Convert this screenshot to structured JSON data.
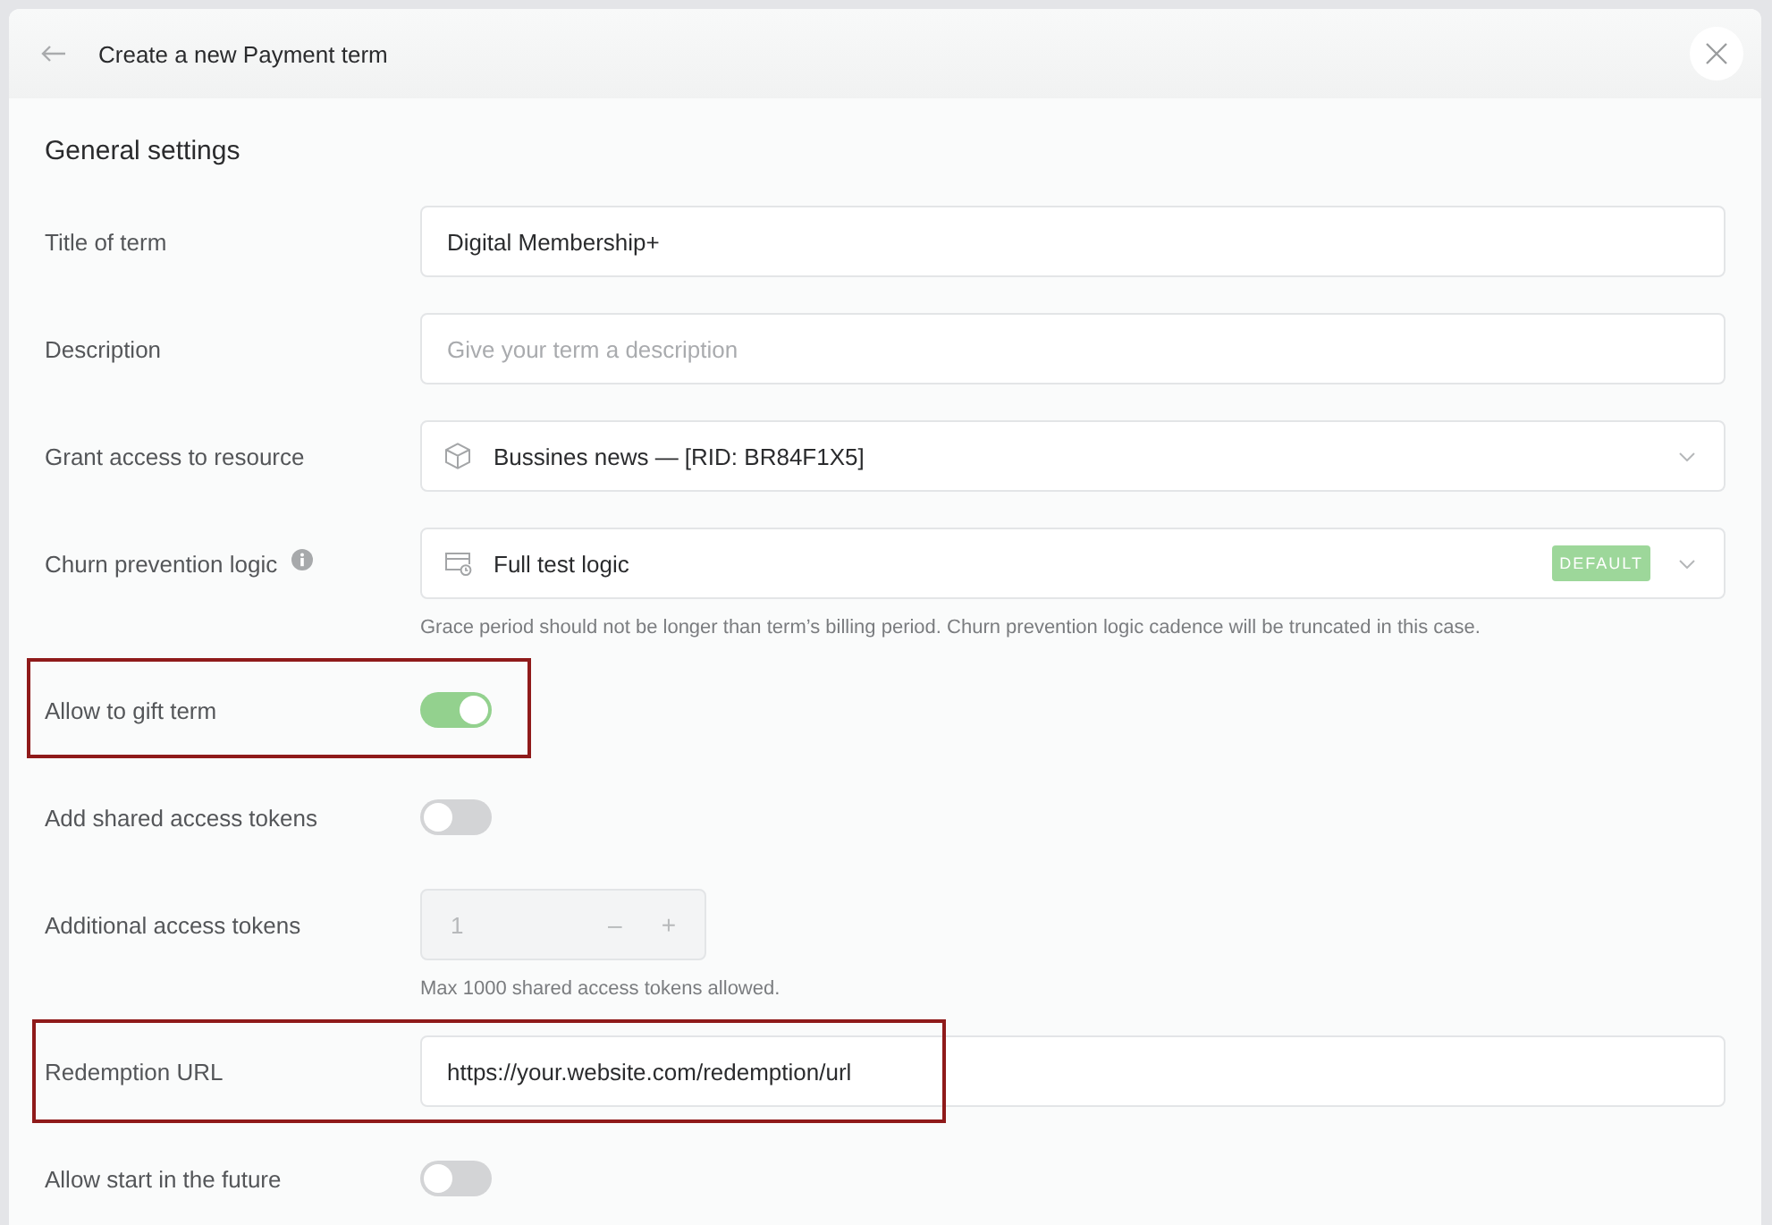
{
  "header": {
    "title": "Create a new Payment term"
  },
  "section": {
    "title": "General settings"
  },
  "fields": [
    {
      "kind": "text",
      "label": "Title of term",
      "value": "Digital Membership+",
      "highlighted": false
    },
    {
      "kind": "text",
      "label": "Description",
      "placeholder": "Give your term a description",
      "highlighted": false
    },
    {
      "kind": "resource",
      "label": "Grant access to resource",
      "value": "Bussines news — [RID: BR84F1X5]",
      "highlighted": false
    },
    {
      "kind": "logic",
      "label": "Churn prevention logic",
      "info_icon": true,
      "value": "Full test logic",
      "badge": "DEFAULT",
      "hint": "Grace period should not be longer than term’s billing period. Churn prevention logic cadence will be truncated in this case.",
      "highlighted": false
    },
    {
      "kind": "toggle",
      "label": "Allow to gift term",
      "on": true,
      "highlighted": true
    },
    {
      "kind": "toggle",
      "label": "Add shared access tokens",
      "on": false,
      "highlighted": false
    },
    {
      "kind": "stepper",
      "label": "Additional access tokens",
      "value": "1",
      "decrement": "–",
      "increment": "+",
      "disabled": true,
      "hint": "Max 1000 shared access tokens allowed.",
      "highlighted": false
    },
    {
      "kind": "text",
      "label": "Redemption URL",
      "value": "https://your.website.com/redemption/url",
      "highlighted": true
    },
    {
      "kind": "toggle",
      "label": "Allow start in the future",
      "on": false,
      "highlighted": false
    }
  ]
}
